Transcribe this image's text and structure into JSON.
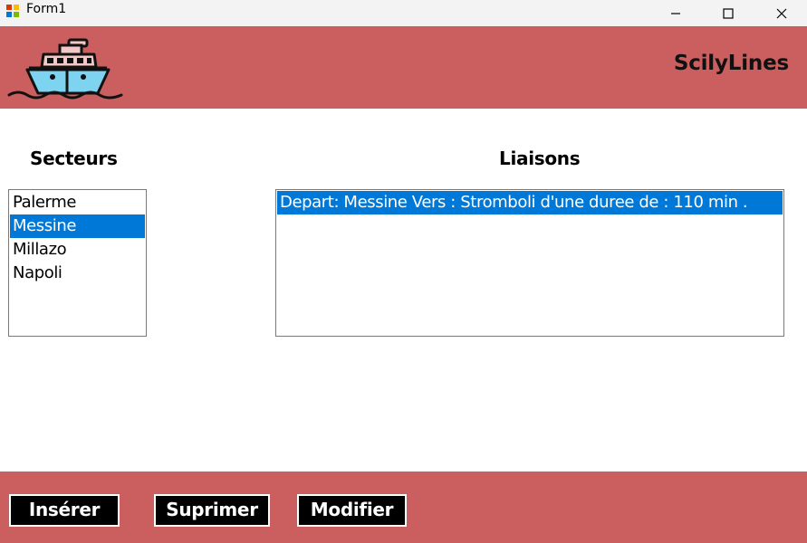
{
  "window": {
    "title": "Form1",
    "app_icon": "winforms-app-icon",
    "controls": [
      "minimize-icon",
      "maximize-icon",
      "close-icon"
    ]
  },
  "header": {
    "logo": "ship-icon",
    "brand": "ScilyLines"
  },
  "secteurs": {
    "heading": "Secteurs",
    "items": [
      {
        "label": "Palerme",
        "selected": false
      },
      {
        "label": "Messine",
        "selected": true
      },
      {
        "label": "Millazo",
        "selected": false
      },
      {
        "label": "Napoli",
        "selected": false
      }
    ]
  },
  "liaisons": {
    "heading": "Liaisons",
    "items": [
      {
        "label": "Depart: Messine Vers : Stromboli d'une duree de : 110 min .",
        "selected": true
      }
    ]
  },
  "footer": {
    "inserer_label": "Insérer",
    "suprimer_label": "Suprimer",
    "modifier_label": "Modifier"
  },
  "colors": {
    "band": "#cb5e5e",
    "selection": "#0078d7",
    "button_bg": "#000000",
    "button_text": "#ffffff"
  }
}
